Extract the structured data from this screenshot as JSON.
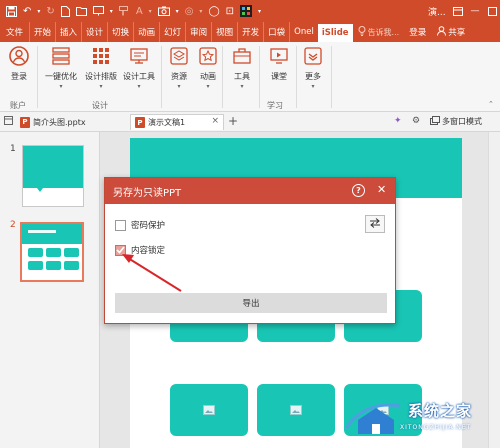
{
  "titlebar": {
    "title": "演...",
    "colors": {
      "accent": "#d04b2a",
      "teal": "#19c6b5",
      "dialog_header": "#cc4b3a"
    }
  },
  "tabs": [
    "文件",
    "开始",
    "插入",
    "设计",
    "切换",
    "动画",
    "幻灯",
    "审阅",
    "视图",
    "开发",
    "口袋",
    "Onel",
    "iSlide"
  ],
  "tell_me": "告诉我...",
  "login": "登录",
  "share": "共享",
  "ribbon": {
    "buttons": [
      {
        "label": "登录",
        "icon": "user-circle-icon"
      },
      {
        "label": "一键优化",
        "icon": "optimize-icon"
      },
      {
        "label": "设计排版",
        "icon": "grid-icon"
      },
      {
        "label": "设计工具",
        "icon": "design-tools-icon"
      },
      {
        "label": "资源",
        "icon": "layers-icon"
      },
      {
        "label": "动画",
        "icon": "star-icon"
      },
      {
        "label": "工具",
        "icon": "toolbox-icon"
      },
      {
        "label": "课堂",
        "icon": "classroom-icon"
      },
      {
        "label": "更多",
        "icon": "more-icon"
      }
    ],
    "groups": [
      "账户",
      "设计",
      "学习"
    ]
  },
  "doc_tabs": [
    {
      "name": "简介头图.pptx",
      "active": false
    },
    {
      "name": "演示文稿1",
      "active": true
    }
  ],
  "multi_window": "多窗口模式",
  "slides": [
    {
      "number": "1"
    },
    {
      "number": "2",
      "selected": true
    }
  ],
  "dialog": {
    "title": "另存为只读PPT",
    "help": "?",
    "close": "✕",
    "options": [
      {
        "label": "密码保护",
        "checked": false
      },
      {
        "label": "内容锁定",
        "checked": true
      }
    ],
    "export_label": "导出"
  },
  "watermark": {
    "cn": "系统之家",
    "en": "XITONGZHIJIA.NET"
  }
}
